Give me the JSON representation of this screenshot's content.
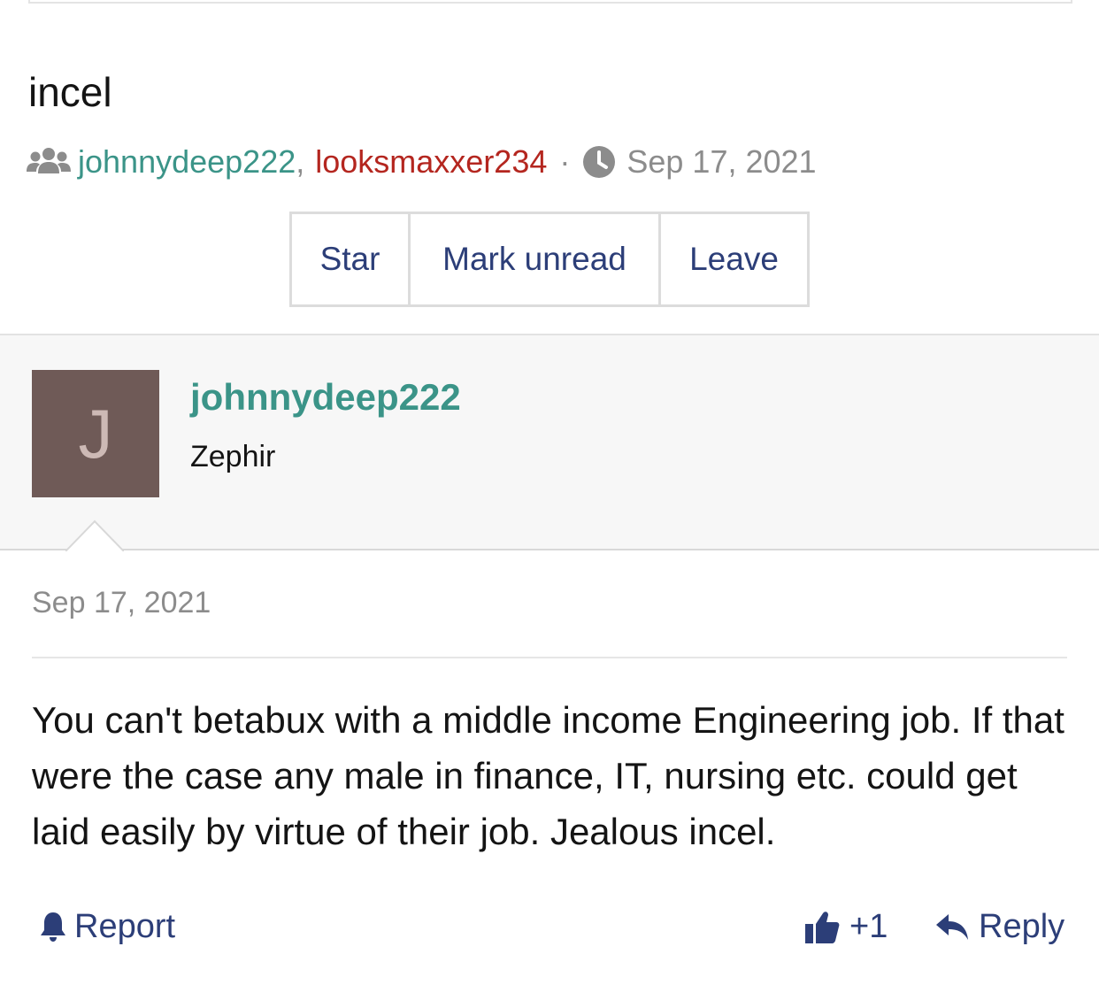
{
  "thread": {
    "title": "incel",
    "participants": [
      {
        "name": "johnnydeep222",
        "color": "#3b9488"
      },
      {
        "name": "looksmaxxer234",
        "color": "#b4261f"
      }
    ],
    "separator_comma": ",",
    "separator_dot": "·",
    "date": "Sep 17, 2021"
  },
  "actions": {
    "star": "Star",
    "mark_unread": "Mark unread",
    "leave": "Leave"
  },
  "post": {
    "avatar_letter": "J",
    "avatar_color": "#6f5a57",
    "author": "johnnydeep222",
    "author_title": "Zephir",
    "date": "Sep 17, 2021",
    "body": "You can't betabux with a middle income Engineering job. If that were the case any male in finance, IT, nursing etc. could get laid easily by virtue of their job. Jealous incel.",
    "footer": {
      "report": "Report",
      "like_count": "+1",
      "reply": "Reply"
    }
  },
  "icons": [
    "users-icon",
    "clock-icon",
    "bell-icon",
    "thumbs-up-icon",
    "reply-icon"
  ],
  "colors": {
    "accent": "#2c3e78",
    "username": "#3b9488",
    "username_alt": "#b4261f",
    "muted": "#8c8c8c"
  }
}
